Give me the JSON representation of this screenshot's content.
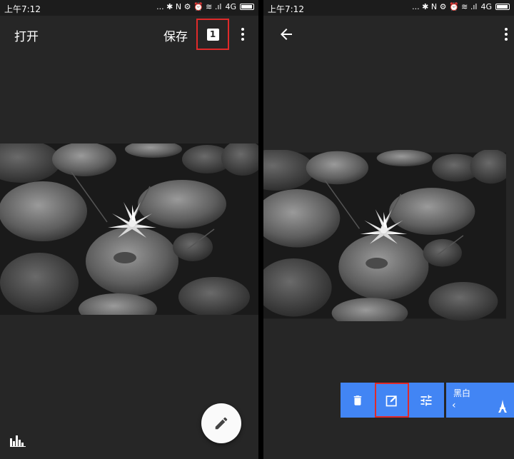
{
  "left_screen": {
    "status_bar": {
      "time": "上午7:12",
      "icons_text": "... ✱ N ⚙ ⏰ ≋ .ıl",
      "network": "4G"
    },
    "app_bar": {
      "open_label": "打开",
      "save_label": "保存",
      "image_count": "1"
    },
    "histogram_icon": "histogram-icon",
    "fab_icon": "pencil-icon"
  },
  "right_screen": {
    "status_bar": {
      "time": "上午7:12",
      "icons_text": "... ✱ N ⚙ ⏰ ≋ .ıl",
      "network": "4G"
    },
    "toolbar": {
      "tools": [
        {
          "name": "delete",
          "icon": "trash-icon"
        },
        {
          "name": "edit",
          "icon": "edit-square-icon",
          "selected": true
        },
        {
          "name": "adjust",
          "icon": "sliders-icon"
        }
      ]
    },
    "filter": {
      "name": "黑白",
      "prev": "‹",
      "icon": "eiffel-tower-icon"
    }
  },
  "colors": {
    "background": "#262626",
    "accent_blue": "#4285f4",
    "highlight_red": "#e02a2a",
    "fab": "#fafafa"
  }
}
